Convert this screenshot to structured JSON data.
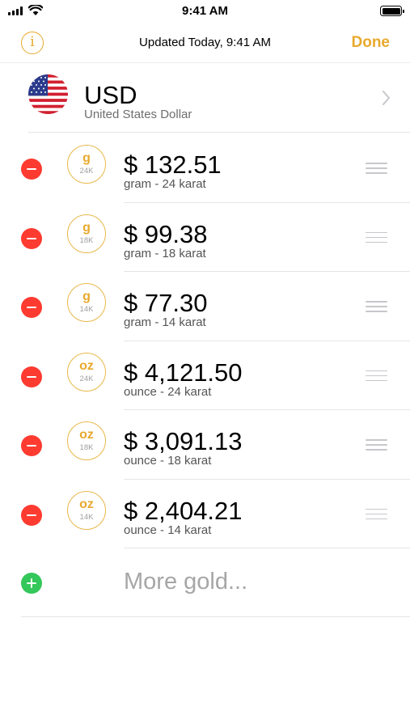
{
  "status_bar": {
    "time": "9:41 AM"
  },
  "nav": {
    "info_icon_glyph": "i",
    "title": "Updated Today, 9:41 AM",
    "done_label": "Done"
  },
  "currency": {
    "code": "USD",
    "name": "United States Dollar",
    "flag_icon": "us-flag-icon"
  },
  "gold_items": [
    {
      "unit": "g",
      "karat": "24K",
      "price": "$ 132.51",
      "description": "gram - 24 karat"
    },
    {
      "unit": "g",
      "karat": "18K",
      "price": "$ 99.38",
      "description": "gram - 18 karat"
    },
    {
      "unit": "g",
      "karat": "14K",
      "price": "$ 77.30",
      "description": "gram - 14 karat"
    },
    {
      "unit": "oz",
      "karat": "24K",
      "price": "$ 4,121.50",
      "description": "ounce - 24 karat"
    },
    {
      "unit": "oz",
      "karat": "18K",
      "price": "$ 3,091.13",
      "description": "ounce - 18 karat"
    },
    {
      "unit": "oz",
      "karat": "14K",
      "price": "$ 2,404.21",
      "description": "ounce - 14 karat"
    }
  ],
  "add_row": {
    "label": "More gold..."
  },
  "colors": {
    "accent": "#e8a92d",
    "delete": "#fe3b30",
    "add": "#34c759",
    "separator": "#e5e5e5"
  }
}
